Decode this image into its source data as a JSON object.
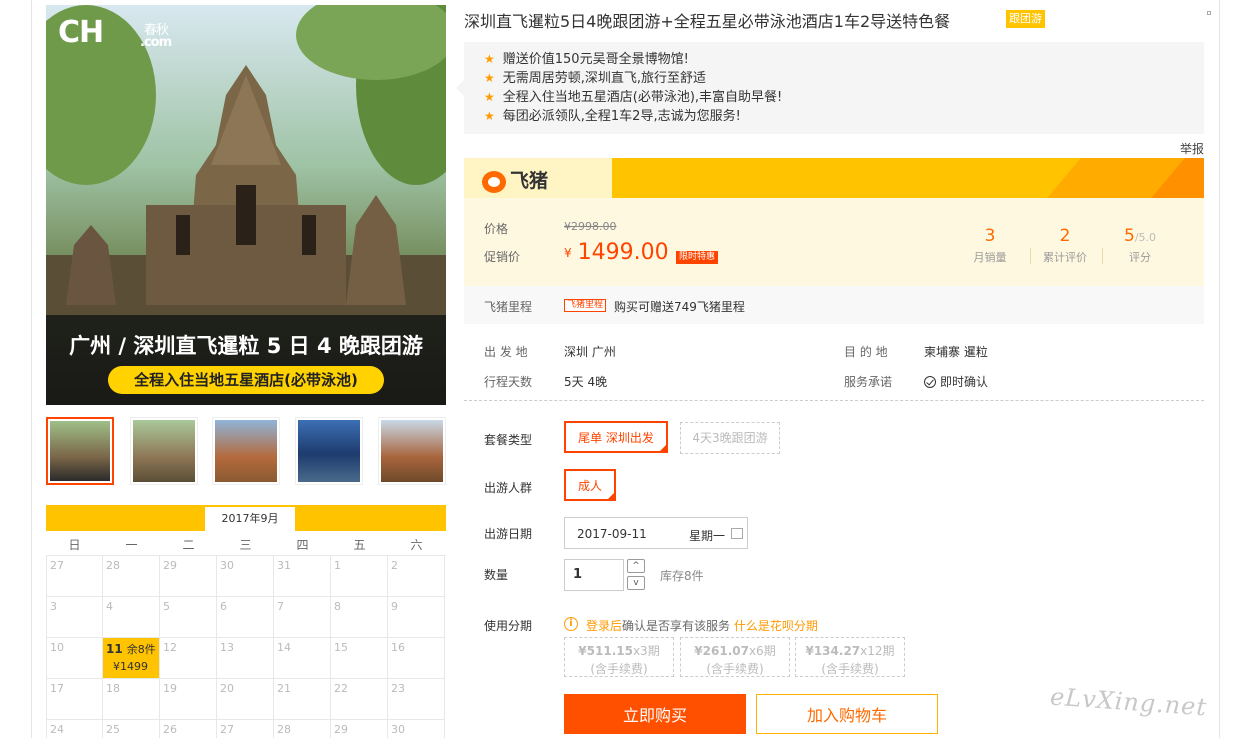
{
  "product": {
    "title": "深圳直飞暹粒5日4晚跟团游+全程五星必带泳池酒店1车2导送特色餐",
    "tag": "跟团游",
    "highlights": [
      "赠送价值150元吴哥全景博物馆!",
      "无需周居劳顿,深圳直飞,旅行至舒适",
      "全程入住当地五星酒店(必带泳池),丰富自助早餐!",
      "每团必派领队,全程1车2导,志诚为您服务!"
    ],
    "report": "举报"
  },
  "hero": {
    "logo": "CH",
    "logo_sub": "春秋",
    "logo_dotcom": ".com",
    "banner_title": "广州 / 深圳直飞暹粒 5 日 4 晚跟团游",
    "banner_sub": "全程入住当地五星酒店(必带泳池)"
  },
  "brand": {
    "name": "飞猪"
  },
  "price": {
    "label": "价格",
    "original": "¥2998.00",
    "promo_label": "促销价",
    "currency": "¥",
    "promo": "1499.00",
    "promo_tag": "限时特惠"
  },
  "stats": [
    {
      "num": "3",
      "suffix": "",
      "label": "月销量"
    },
    {
      "num": "2",
      "suffix": "",
      "label": "累计评价"
    },
    {
      "num": "5",
      "suffix": "/5.0",
      "label": "评分"
    }
  ],
  "mileage": {
    "label": "飞猪里程",
    "badge": "飞猪里程",
    "text": "购买可赠送749飞猪里程"
  },
  "info": {
    "depart_label": "出 发 地",
    "depart": "深圳   广州",
    "dest_label": "目 的 地",
    "dest": "柬埔寨   暹粒",
    "days_label": "行程天数",
    "days": "5天   4晚",
    "service_label": "服务承诺",
    "service": "即时确认"
  },
  "options": {
    "package_label": "套餐类型",
    "package_selected": "尾单 深圳出发",
    "package_other": "4天3晚跟团游",
    "crowd_label": "出游人群",
    "crowd_selected": "成人",
    "date_label": "出游日期",
    "date": "2017-09-11",
    "weekday": "星期一",
    "qty_label": "数量",
    "qty": "1",
    "stock": "库存8件",
    "step_up": "^",
    "step_down": "v"
  },
  "installment": {
    "label": "使用分期",
    "warn": "i",
    "login": "登录后",
    "tip": "确认是否享有该服务",
    "link": "什么是花呗分期",
    "plans": [
      {
        "amount": "¥511.15",
        "period": "x3期",
        "fee": "(含手续费)"
      },
      {
        "amount": "¥261.07",
        "period": "x6期",
        "fee": "(含手续费)"
      },
      {
        "amount": "¥134.27",
        "period": "x12期",
        "fee": "(含手续费)"
      }
    ]
  },
  "actions": {
    "buy": "立即购买",
    "cart": "加入购物车"
  },
  "calendar": {
    "month": "2017年9月",
    "weekdays": [
      "日",
      "一",
      "二",
      "三",
      "四",
      "五",
      "六"
    ],
    "rows": [
      [
        "27",
        "28",
        "29",
        "30",
        "31",
        "1",
        "2"
      ],
      [
        "3",
        "4",
        "5",
        "6",
        "7",
        "8",
        "9"
      ],
      [
        "10",
        "11",
        "12",
        "13",
        "14",
        "15",
        "16"
      ],
      [
        "17",
        "18",
        "19",
        "20",
        "21",
        "22",
        "23"
      ],
      [
        "24",
        "25",
        "26",
        "27",
        "28",
        "29",
        "30"
      ]
    ],
    "selected": {
      "day": "11",
      "stock": "余8件",
      "price": "¥1499"
    }
  },
  "watermark": "eLvXing.net",
  "colors": {
    "accent": "#ff4400",
    "brand": "#ffc300",
    "orange": "#ff6a00"
  }
}
